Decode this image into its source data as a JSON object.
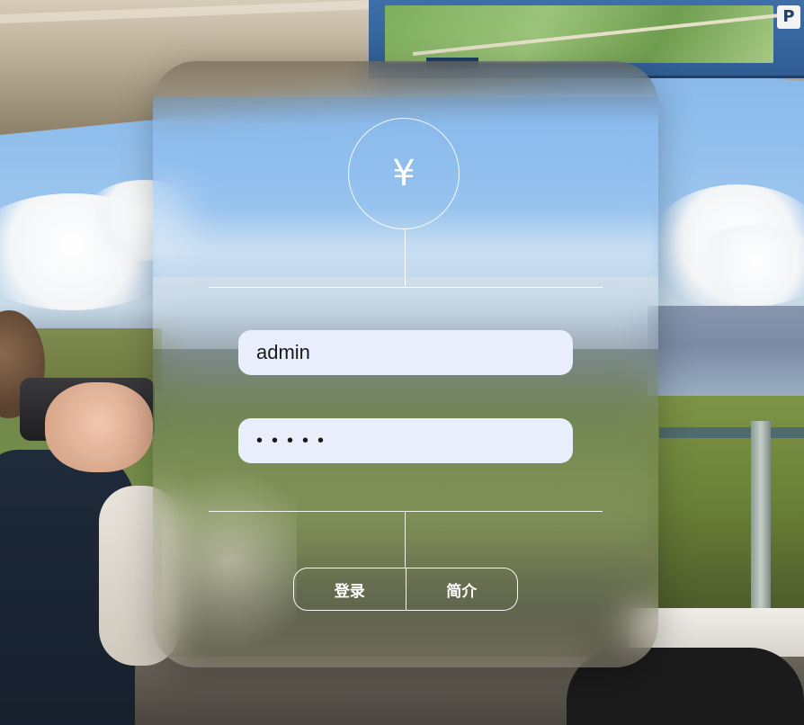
{
  "background": {
    "map_sign": {
      "parking_label": "P"
    }
  },
  "login_card": {
    "logo_symbol": "¥",
    "username": {
      "value": "admin"
    },
    "password": {
      "value": "•••••"
    },
    "buttons": {
      "login_label": "登录",
      "intro_label": "简介"
    }
  },
  "colors": {
    "input_background": "#e8eefb",
    "line_color": "#ffffff",
    "button_text": "#ffffff"
  }
}
